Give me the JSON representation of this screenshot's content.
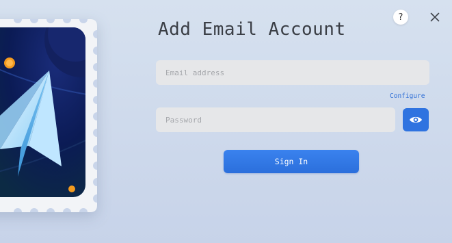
{
  "dialog": {
    "title": "Add Email Account",
    "help_label": "?",
    "close_icon": "close-icon"
  },
  "form": {
    "email_placeholder": "Email address",
    "email_value": "",
    "configure_label": "Configure",
    "password_placeholder": "Password",
    "password_value": "",
    "show_password_icon": "eye-icon",
    "signin_label": "Sign In"
  },
  "illustration": {
    "icon": "paper-plane-stamp-illustration"
  },
  "colors": {
    "accent": "#2f73e0",
    "background": "#d6e1ef",
    "field_bg": "#e6e7e9",
    "title_text": "#3b3f46"
  }
}
